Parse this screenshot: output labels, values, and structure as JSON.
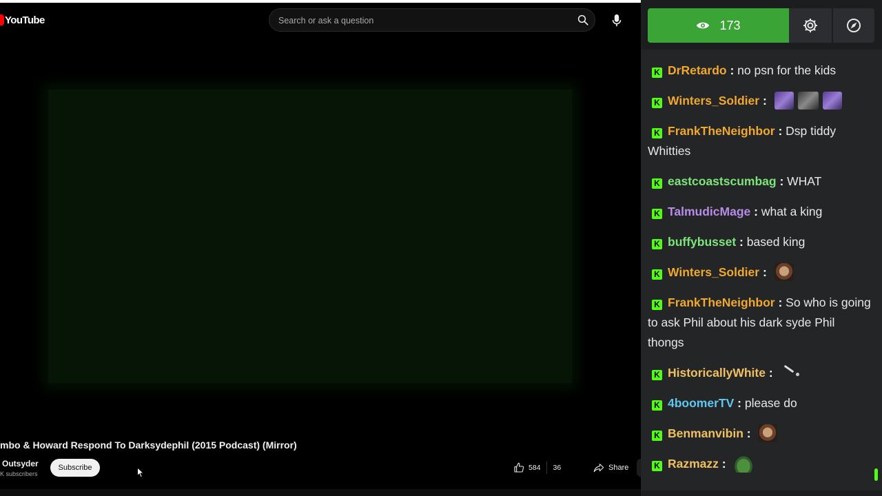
{
  "youtube": {
    "logo_text": "YouTube",
    "search_placeholder": "Search or ask a question",
    "video_title": "mbo & Howard Respond To Darksydephil (2015 Podcast) (Mirror)",
    "channel_name": "Outsyder",
    "channel_subscribers": "K subscribers",
    "subscribe_label": "Subscribe",
    "like_count": "584",
    "dislike_count": "36",
    "share_label": "Share",
    "video_bg_color": "#061506",
    "brand_color": "#ff0000"
  },
  "chat": {
    "viewer_count": "173",
    "accent_color": "#53fc18",
    "badge_letter": "K",
    "messages": [
      {
        "user": "DrRetardo",
        "text": "no psn for the kids",
        "user_color": "#f0a830"
      },
      {
        "user": "Winters_Soldier",
        "text": "",
        "user_color": "#f0a830",
        "emotes": [
          "purple-emote",
          "grey-emote",
          "purple-emote"
        ]
      },
      {
        "user": "FrankTheNeighbor",
        "text": "Dsp tiddy Whitties",
        "user_color": "#f0a830"
      },
      {
        "user": "eastcoastscumbag",
        "text": "WHAT",
        "user_color": "#7ee57a"
      },
      {
        "user": "TalmudicMage",
        "text": "what a king",
        "user_color": "#b98ce8"
      },
      {
        "user": "buffybusset",
        "text": "based king",
        "user_color": "#7ee57a"
      },
      {
        "user": "Winters_Soldier",
        "text": "",
        "user_color": "#f0a830",
        "emotes": [
          "face-emote"
        ]
      },
      {
        "user": "FrankTheNeighbor",
        "text": "So who is going to ask Phil about his dark syde Phil thongs",
        "user_color": "#f0a830"
      },
      {
        "user": "HistoricallyWhite",
        "text": "",
        "user_color": "#f0c060",
        "emotes": [
          "feather-emote"
        ]
      },
      {
        "user": "4boomerTV",
        "text": "please do",
        "user_color": "#5ec8f0"
      },
      {
        "user": "Benmanvibin",
        "text": "",
        "user_color": "#f0c060",
        "emotes": [
          "face-emote"
        ]
      },
      {
        "user": "Razmazz",
        "text": "",
        "user_color": "#f0c060",
        "emotes": [
          "frog-emote"
        ]
      }
    ]
  }
}
